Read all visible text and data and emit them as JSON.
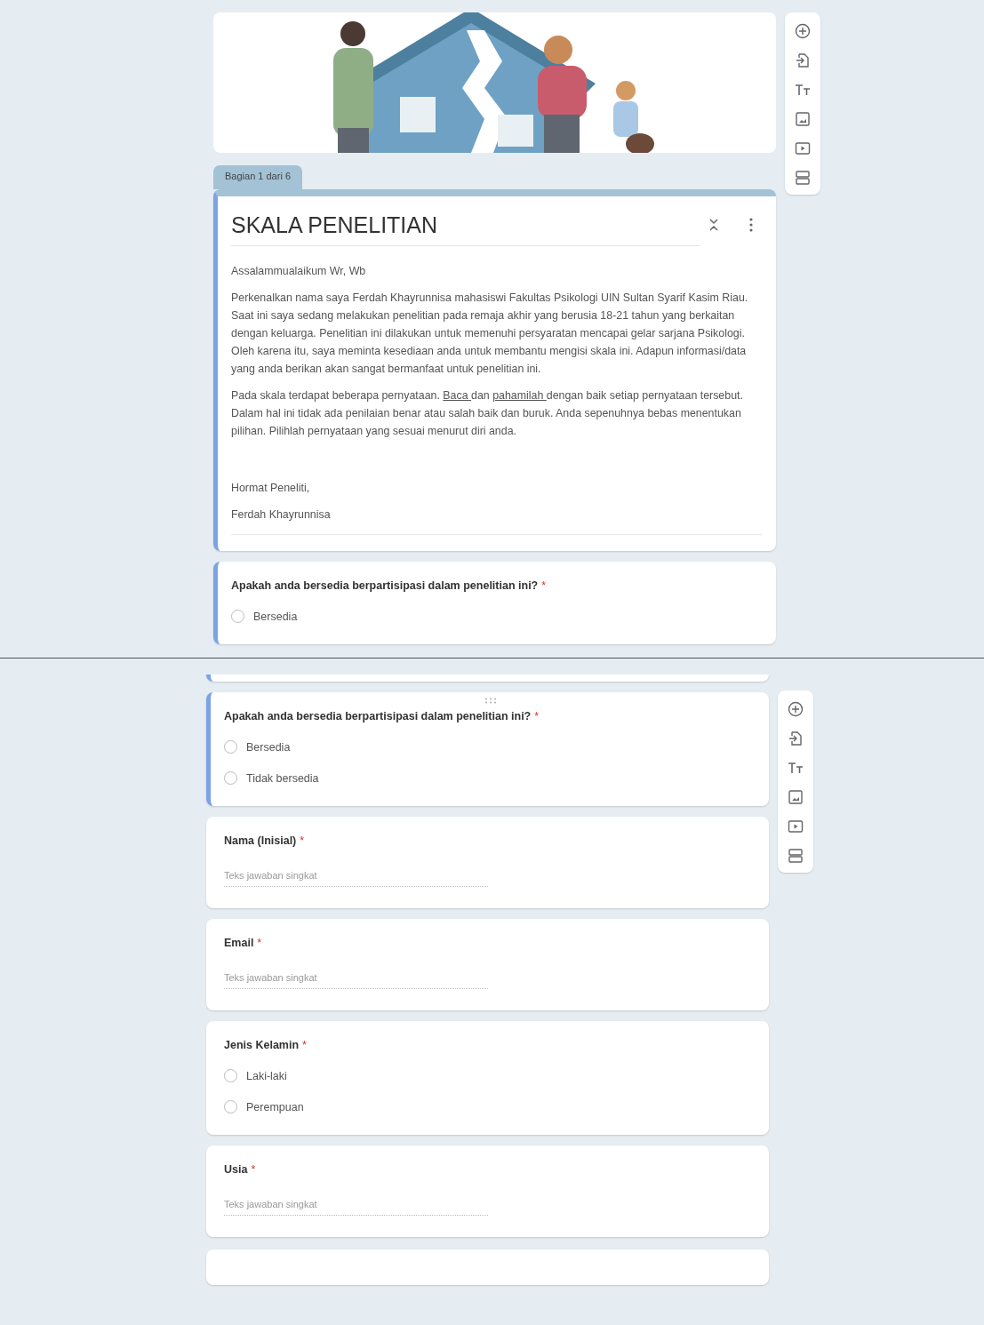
{
  "top": {
    "section_tab": "Bagian 1 dari 6",
    "title_card": {
      "focused": true,
      "title": "SKALA PENELITIAN",
      "paragraphs": [
        [
          {
            "text": "Assalammualaikum Wr, Wb",
            "underlined": false
          }
        ],
        [
          {
            "text": "Perkenalkan nama saya Ferdah Khayrunnisa mahasiswi Fakultas Psikologi UIN Sultan Syarif Kasim Riau. Saat ini saya sedang melakukan penelitian pada remaja akhir yang berusia 18-21 tahun yang berkaitan dengan keluarga. Penelitian ini dilakukan untuk memenuhi persyaratan mencapai gelar sarjana Psikologi. Oleh karena itu, saya meminta kesediaan anda untuk membantu mengisi skala ini. Adapun informasi/data yang anda berikan akan sangat bermanfaat untuk penelitian ini.",
            "underlined": false
          }
        ],
        [
          {
            "text": "Pada skala terdapat beberapa pernyataan. ",
            "underlined": false
          },
          {
            "text": "Baca ",
            "underlined": true
          },
          {
            "text": "dan ",
            "underlined": false
          },
          {
            "text": "pahamilah ",
            "underlined": true
          },
          {
            "text": "dengan baik setiap pernyataan tersebut. Dalam hal ini tidak ada penilaian benar atau salah baik dan buruk. Anda sepenuhnya bebas menentukan pilihan. Pilihlah pernyataan yang sesuai menurut diri anda.",
            "underlined": false
          }
        ]
      ],
      "closing": [
        "Hormat Peneliti,",
        "Ferdah Khayrunnisa"
      ]
    },
    "questions": [
      {
        "kind": "radio",
        "focused": true,
        "title": "Apakah anda bersedia berpartisipasi dalam penelitian ini?",
        "required_mark": "*",
        "options": [
          {
            "label": "Bersedia",
            "selected": false
          }
        ]
      }
    ]
  },
  "bottom": {
    "questions": [
      {
        "kind": "radio",
        "focused": true,
        "title": "Apakah anda bersedia berpartisipasi dalam penelitian ini?",
        "required_mark": "*",
        "options": [
          {
            "label": "Bersedia",
            "selected": false
          },
          {
            "label": "Tidak bersedia",
            "selected": false
          }
        ]
      },
      {
        "kind": "short_text",
        "focused": false,
        "title": "Nama (Inisial)",
        "required_mark": "*",
        "placeholder": "Teks jawaban singkat"
      },
      {
        "kind": "short_text",
        "focused": false,
        "title": "Email",
        "required_mark": "*",
        "placeholder": "Teks jawaban singkat"
      },
      {
        "kind": "radio",
        "focused": false,
        "title": "Jenis Kelamin",
        "required_mark": "*",
        "options": [
          {
            "label": "Laki-laki",
            "selected": false
          },
          {
            "label": "Perempuan",
            "selected": false
          }
        ]
      },
      {
        "kind": "short_text",
        "focused": false,
        "title": "Usia",
        "required_mark": "*",
        "placeholder": "Teks jawaban singkat"
      }
    ]
  }
}
